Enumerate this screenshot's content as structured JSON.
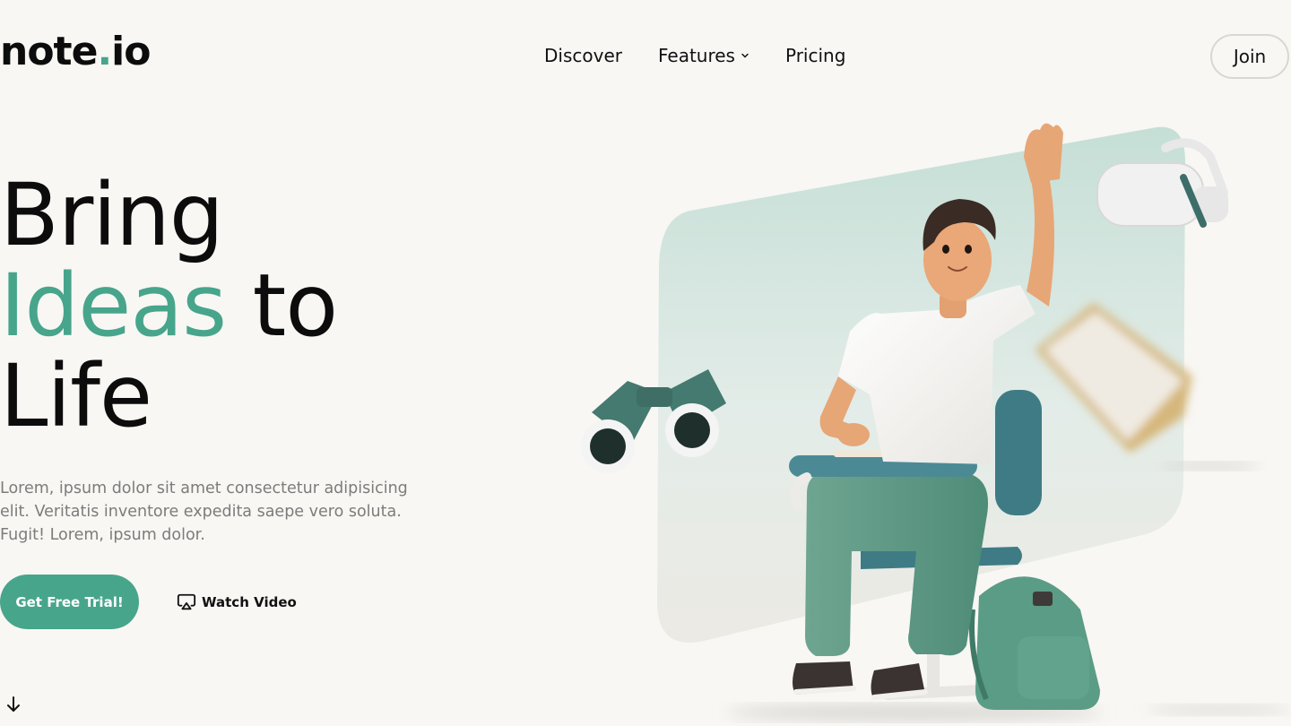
{
  "brand": {
    "name_left": "note",
    "name_dot": ".",
    "name_right": "io"
  },
  "nav": {
    "items": [
      {
        "label": "Discover"
      },
      {
        "label": "Features"
      },
      {
        "label": "Pricing"
      }
    ],
    "join_label": "Join"
  },
  "hero": {
    "title_line1": "Bring",
    "title_accent": "Ideas",
    "title_after_accent": " to",
    "title_line3": "Life",
    "description": "Lorem, ipsum dolor sit amet consectetur adipisicing elit. Veritatis inventore expedita saepe vero soluta. Fugit! Lorem, ipsum dolor.",
    "primary_cta": "Get Free Trial!",
    "secondary_cta": "Watch Video"
  },
  "colors": {
    "accent": "#47a58b",
    "background": "#f8f7f4",
    "text": "#0c0c0c",
    "muted": "#7c7c7c"
  },
  "icons": {
    "features_dropdown": "chevron-down-icon",
    "watch": "airplay-icon",
    "scroll": "arrow-down-icon"
  }
}
